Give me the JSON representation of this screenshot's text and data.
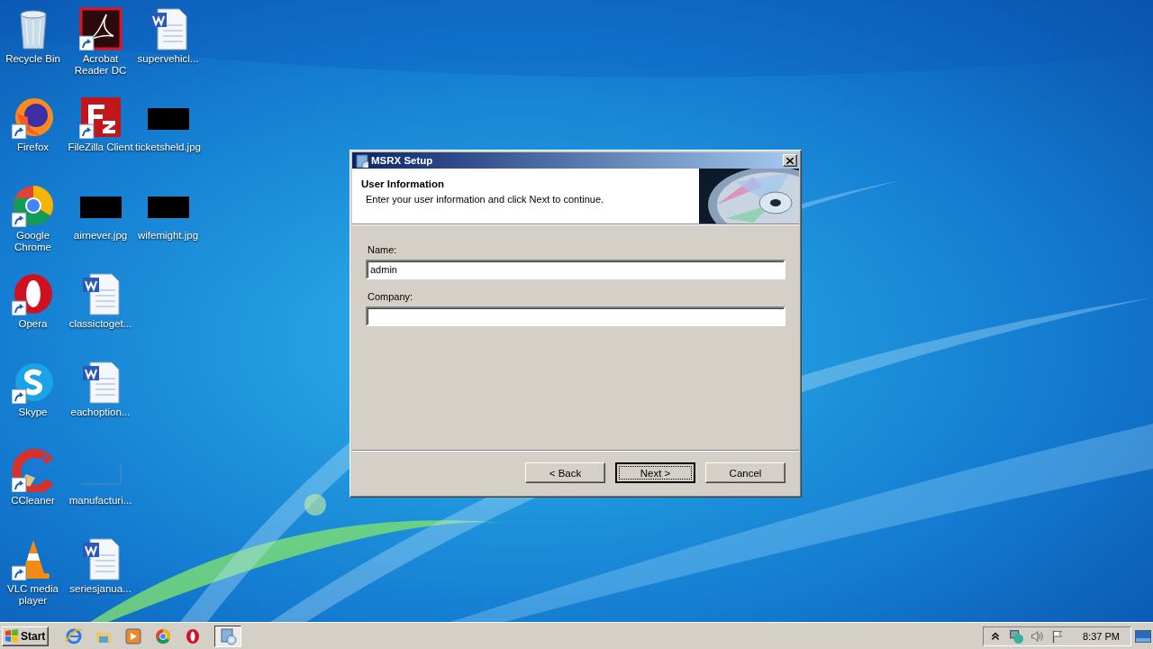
{
  "desktop_icons": [
    {
      "label": "Recycle Bin",
      "kind": "recycle-bin",
      "shortcut": false
    },
    {
      "label": "Firefox",
      "kind": "firefox",
      "shortcut": true
    },
    {
      "label": "Google Chrome",
      "kind": "chrome",
      "shortcut": true
    },
    {
      "label": "Opera",
      "kind": "opera",
      "shortcut": true
    },
    {
      "label": "Skype",
      "kind": "skype",
      "shortcut": true
    },
    {
      "label": "CCleaner",
      "kind": "ccleaner",
      "shortcut": true
    },
    {
      "label": "VLC media player",
      "kind": "vlc",
      "shortcut": true
    },
    {
      "label": "Acrobat Reader DC",
      "kind": "acrobat",
      "shortcut": true
    },
    {
      "label": "FileZilla Client",
      "kind": "filezilla",
      "shortcut": true
    },
    {
      "label": "airnever.jpg",
      "kind": "image-black",
      "shortcut": false
    },
    {
      "label": "classictoget...",
      "kind": "word",
      "shortcut": false
    },
    {
      "label": "eachoption...",
      "kind": "word",
      "shortcut": false
    },
    {
      "label": "manufacturi...",
      "kind": "image-blank",
      "shortcut": false
    },
    {
      "label": "seriesjanua...",
      "kind": "word",
      "shortcut": false
    },
    {
      "label": "supervehicl...",
      "kind": "word",
      "shortcut": false
    },
    {
      "label": "ticketsheld.jpg",
      "kind": "image-black",
      "shortcut": false
    },
    {
      "label": "wifemight.jpg",
      "kind": "image-black",
      "shortcut": false
    }
  ],
  "dialog": {
    "title": "MSRX Setup",
    "heading": "User Information",
    "subheading": "Enter your user information and click Next to continue.",
    "fields": [
      {
        "label": "Name:",
        "value": "admin"
      },
      {
        "label": "Company:"
      }
    ],
    "buttons": [
      {
        "label": "< Back",
        "default": false
      },
      {
        "label": "Next >",
        "default": true
      },
      {
        "label": "Cancel",
        "default": false
      }
    ]
  },
  "taskbar": {
    "start": "Start",
    "quick_launch": [
      {
        "kind": "ie"
      },
      {
        "kind": "folder"
      },
      {
        "kind": "media"
      },
      {
        "kind": "chrome"
      },
      {
        "kind": "opera"
      }
    ],
    "tasks": [
      {
        "kind": "setup",
        "selected": true
      }
    ],
    "tray": [
      {
        "kind": "chevron"
      },
      {
        "kind": "network"
      },
      {
        "kind": "volume"
      },
      {
        "kind": "flag"
      }
    ],
    "clock": "8:37 PM"
  }
}
